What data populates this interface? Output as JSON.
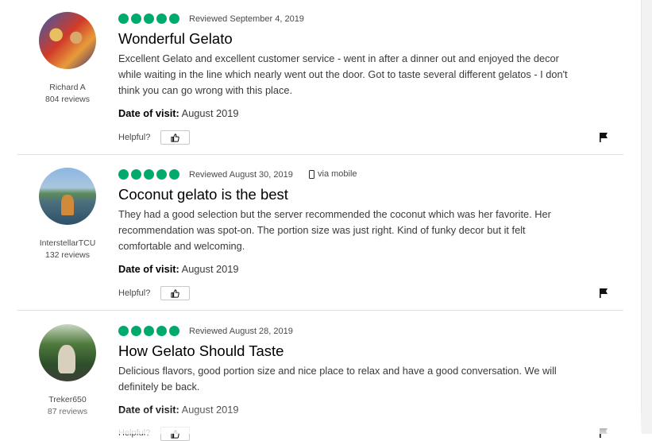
{
  "reviews": [
    {
      "user": {
        "name": "Richard A",
        "reviews": "804 reviews"
      },
      "rating": 5,
      "date": "Reviewed September 4, 2019",
      "mobile": null,
      "title": "Wonderful Gelato",
      "text": "Excellent Gelato and excellent customer service - went in after a dinner out and enjoyed the decor while waiting in the line which nearly went out the door. Got to taste several different gelatos - I don't think you can go wrong with this place.",
      "visit_label": "Date of visit:",
      "visit_value": "August 2019",
      "helpful_label": "Helpful?"
    },
    {
      "user": {
        "name": "InterstellarTCU",
        "reviews": "132 reviews"
      },
      "rating": 5,
      "date": "Reviewed August 30, 2019",
      "mobile": "via mobile",
      "title": "Coconut gelato is the best",
      "text": "They had a good selection but the server recommended the coconut which was her favorite. Her recommendation was spot-on. The portion size was just right. Kind of funky decor but it felt comfortable and welcoming.",
      "visit_label": "Date of visit:",
      "visit_value": "August 2019",
      "helpful_label": "Helpful?"
    },
    {
      "user": {
        "name": "Treker650",
        "reviews": "87 reviews"
      },
      "rating": 5,
      "date": "Reviewed August 28, 2019",
      "mobile": null,
      "title": "How Gelato Should Taste",
      "text": "Delicious flavors, good portion size and nice place to relax and have a good conversation. We will definitely be back.",
      "visit_label": "Date of visit:",
      "visit_value": "August 2019",
      "helpful_label": "Helpful?"
    }
  ],
  "icons": {
    "rating": "rating-bubble-icon",
    "mobile": "mobile-phone-icon",
    "helpful": "thumbs-up-icon",
    "report": "flag-icon"
  },
  "colors": {
    "rating_green": "#00aa6c"
  }
}
